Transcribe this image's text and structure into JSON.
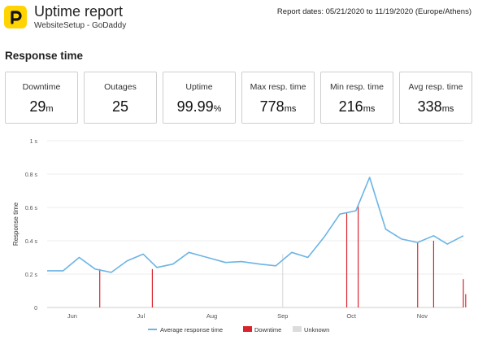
{
  "header": {
    "logo_icon": "pingdom-p-logo",
    "title": "Uptime report",
    "subtitle": "WebsiteSetup - GoDaddy",
    "report_dates": "Report dates: 05/21/2020 to 11/19/2020 (Europe/Athens)"
  },
  "section_title": "Response time",
  "stats": [
    {
      "label": "Downtime",
      "value": "29",
      "unit": "m"
    },
    {
      "label": "Outages",
      "value": "25",
      "unit": ""
    },
    {
      "label": "Uptime",
      "value": "99.99",
      "unit": "%"
    },
    {
      "label": "Max resp. time",
      "value": "778",
      "unit": "ms"
    },
    {
      "label": "Min resp. time",
      "value": "216",
      "unit": "ms"
    },
    {
      "label": "Avg resp. time",
      "value": "338",
      "unit": "ms"
    }
  ],
  "colors": {
    "line": "#6cb4e4",
    "downtime": "#d9232d",
    "unknown": "#dcdcdc",
    "grid": "#eeeeee",
    "logo": "#ffd400"
  },
  "chart_data": {
    "type": "line",
    "ylabel": "Response time",
    "ylim": [
      0,
      1
    ],
    "y_ticks": [
      "0",
      "0.2 s",
      "0.4 s",
      "0.6 s",
      "0.8 s",
      "1 s"
    ],
    "y_tick_values": [
      0,
      0.2,
      0.4,
      0.6,
      0.8,
      1
    ],
    "x_ticks": [
      "Jun",
      "Jul",
      "Aug",
      "Sep",
      "Oct",
      "Nov"
    ],
    "x_tick_values": [
      "2020-06-01",
      "2020-07-01",
      "2020-08-01",
      "2020-09-01",
      "2020-10-01",
      "2020-11-01"
    ],
    "xlim": [
      "2020-05-21",
      "2020-11-19"
    ],
    "grid": "horizontal",
    "legend_position": "bottom",
    "series": [
      {
        "name": "Average response time",
        "x": [
          "2020-05-21",
          "2020-05-28",
          "2020-06-04",
          "2020-06-11",
          "2020-06-18",
          "2020-06-25",
          "2020-07-02",
          "2020-07-08",
          "2020-07-15",
          "2020-07-22",
          "2020-07-30",
          "2020-08-07",
          "2020-08-14",
          "2020-08-22",
          "2020-08-29",
          "2020-09-05",
          "2020-09-12",
          "2020-09-19",
          "2020-09-26",
          "2020-10-03",
          "2020-10-09",
          "2020-10-16",
          "2020-10-23",
          "2020-10-30",
          "2020-11-06",
          "2020-11-12",
          "2020-11-19"
        ],
        "values": [
          0.22,
          0.22,
          0.3,
          0.23,
          0.21,
          0.28,
          0.32,
          0.24,
          0.26,
          0.33,
          0.3,
          0.27,
          0.275,
          0.26,
          0.25,
          0.33,
          0.3,
          0.42,
          0.56,
          0.58,
          0.78,
          0.47,
          0.41,
          0.39,
          0.43,
          0.38,
          0.43
        ]
      }
    ],
    "downtime_dates": [
      "2020-06-13",
      "2020-07-06",
      "2020-09-29",
      "2020-10-04",
      "2020-10-30",
      "2020-11-06",
      "2020-11-19",
      "2020-11-20"
    ],
    "downtime_heights": [
      0.23,
      0.23,
      0.57,
      0.61,
      0.39,
      0.4,
      0.17,
      0.08
    ],
    "unknown_dates": [
      "2020-09-01"
    ],
    "legend": [
      "Average response time",
      "Downtime",
      "Unknown"
    ]
  }
}
